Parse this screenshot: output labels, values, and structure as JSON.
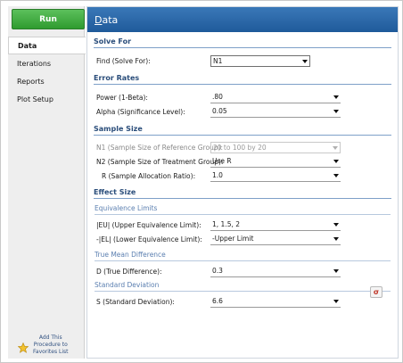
{
  "sidebar": {
    "run_label": "Run",
    "items": [
      {
        "label": "Data",
        "active": true
      },
      {
        "label": "Iterations",
        "active": false
      },
      {
        "label": "Reports",
        "active": false
      },
      {
        "label": "Plot Setup",
        "active": false
      }
    ],
    "favorites_label_line1": "Add This",
    "favorites_label_line2": "Procedure to",
    "favorites_label_line3": "Favorites List"
  },
  "main": {
    "title": "Data",
    "sections": {
      "solve_for": "Solve For",
      "error_rates": "Error Rates",
      "sample_size": "Sample Size",
      "effect_size": "Effect Size"
    },
    "fields": {
      "find_label": "Find (Solve For):",
      "find_value": "N1",
      "power_label": "Power (1-Beta):",
      "power_value": ".80",
      "alpha_label": "Alpha (Significance Level):",
      "alpha_value": "0.05",
      "n1_label": "N1 (Sample Size of Reference Group):",
      "n1_value": "20 to 100 by 20",
      "n2_label": "N2 (Sample Size of Treatment Group):",
      "n2_value": "Use R",
      "r_label": "R (Sample Allocation Ratio):",
      "r_value": "1.0",
      "equivalence_limits": "Equivalence Limits",
      "eu_label": "|EU| (Upper Equivalence Limit):",
      "eu_value": "1, 1.5, 2",
      "el_label": "-|EL| (Lower Equivalence Limit):",
      "el_value": "-Upper Limit",
      "true_mean_diff": "True Mean Difference",
      "d_label": "D (True Difference):",
      "d_value": "0.3",
      "std_dev": "Standard Deviation",
      "s_label": "S (Standard Deviation):",
      "s_value": "6.6",
      "sigma_button": "σ"
    }
  },
  "colors": {
    "title_bar": "#2a68a8",
    "run_button": "#3aaa3a",
    "section_header": "#2a4d7a"
  }
}
